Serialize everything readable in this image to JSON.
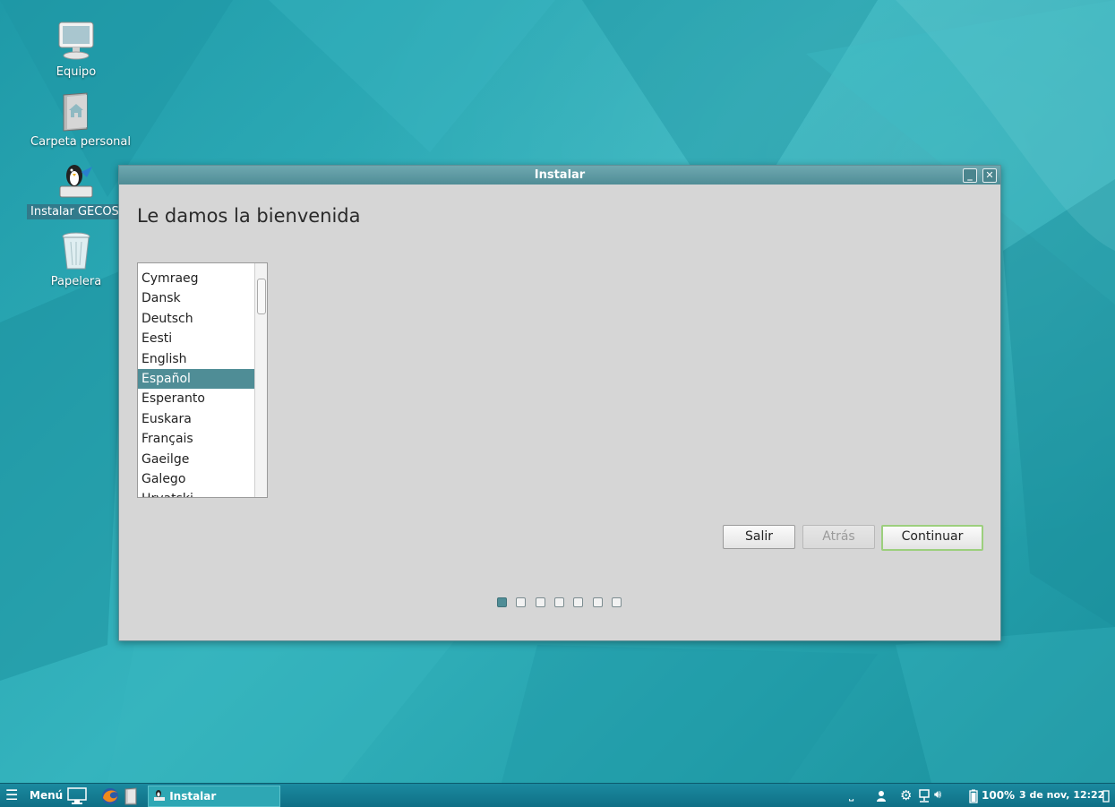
{
  "desktop": {
    "icons": [
      {
        "label": "Equipo",
        "icon": "computer-icon"
      },
      {
        "label": "Carpeta personal",
        "icon": "home-folder-icon"
      },
      {
        "label": "Instalar GECOS v",
        "icon": "installer-penguin-icon"
      },
      {
        "label": "Papelera",
        "icon": "trash-icon"
      }
    ]
  },
  "window": {
    "title": "Instalar",
    "heading": "Le damos la bienvenida",
    "languages": [
      "Cymraeg",
      "Dansk",
      "Deutsch",
      "Eesti",
      "English",
      "Español",
      "Esperanto",
      "Euskara",
      "Français",
      "Gaeilge",
      "Galego",
      "Hrvatski"
    ],
    "selected_language": "Español",
    "buttons": {
      "quit": "Salir",
      "back": "Atrás",
      "continue": "Continuar"
    },
    "progress": {
      "current_step": 1,
      "total_steps": 7
    }
  },
  "taskbar": {
    "menu_label": "Menú",
    "task_label": "Instalar",
    "battery": "100%",
    "clock": "3 de nov, 12:22"
  },
  "colors": {
    "accent": "#4f8d96",
    "desktop": "#2aa6b2",
    "taskbar": "#1b8aa0",
    "default_button_border": "#9ccf7d"
  }
}
